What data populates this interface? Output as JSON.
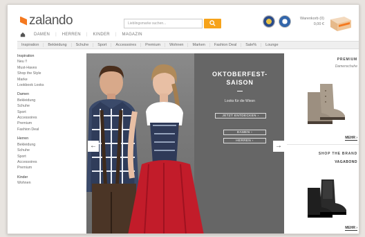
{
  "header": {
    "logo": "zalando",
    "gender_nav": [
      "DAMEN",
      "HERREN",
      "KINDER",
      "MAGAZIN"
    ],
    "search_placeholder": "Lieblingsmarke suchen...",
    "cart": {
      "label": "Warenkorb (0)",
      "amount": "0,00 €"
    }
  },
  "category_bar": [
    "Inspiration",
    "Bekleidung",
    "Schuhe",
    "Sport",
    "Accessoires",
    "Premium",
    "Wohnen",
    "Marken",
    "Fashion Deal",
    "Sale%",
    "Lounge"
  ],
  "sidebar": {
    "groups": [
      {
        "header": "Inspiration",
        "items": [
          "Neu !!",
          "Must-Haves",
          "Shop the Style",
          "Marke",
          "Lookbook Looks"
        ]
      },
      {
        "header": "Damen",
        "items": [
          "Bekleidung",
          "Schuhe",
          "Sport",
          "Accessoires",
          "Premium",
          "Fashion Deal"
        ]
      },
      {
        "header": "Herren",
        "items": [
          "Bekleidung",
          "Schuhe",
          "Sport",
          "Accessoires",
          "Premium"
        ]
      },
      {
        "header": "Kinder",
        "items": [
          "Wohnen"
        ]
      }
    ]
  },
  "hero": {
    "title_line1": "OKTOBERFEST-",
    "title_line2": "SAISON",
    "subtitle": "Looks für die Wiesn",
    "button_main": "JETZT ENTDECKEN ›",
    "button_women": "DAMEN ›",
    "button_men": "HERREN ›",
    "arrow_left": "←",
    "arrow_right": "→"
  },
  "promo_premium": {
    "title": "PREMIUM",
    "subtitle": "Damenschuhe",
    "more": "MEHR ›"
  },
  "promo_brand": {
    "title": "SHOP THE BRAND",
    "brand": "VAGABOND",
    "more": "MEHR ›"
  },
  "colors": {
    "brand_orange": "#f47920",
    "search_button": "#f6a31b"
  }
}
